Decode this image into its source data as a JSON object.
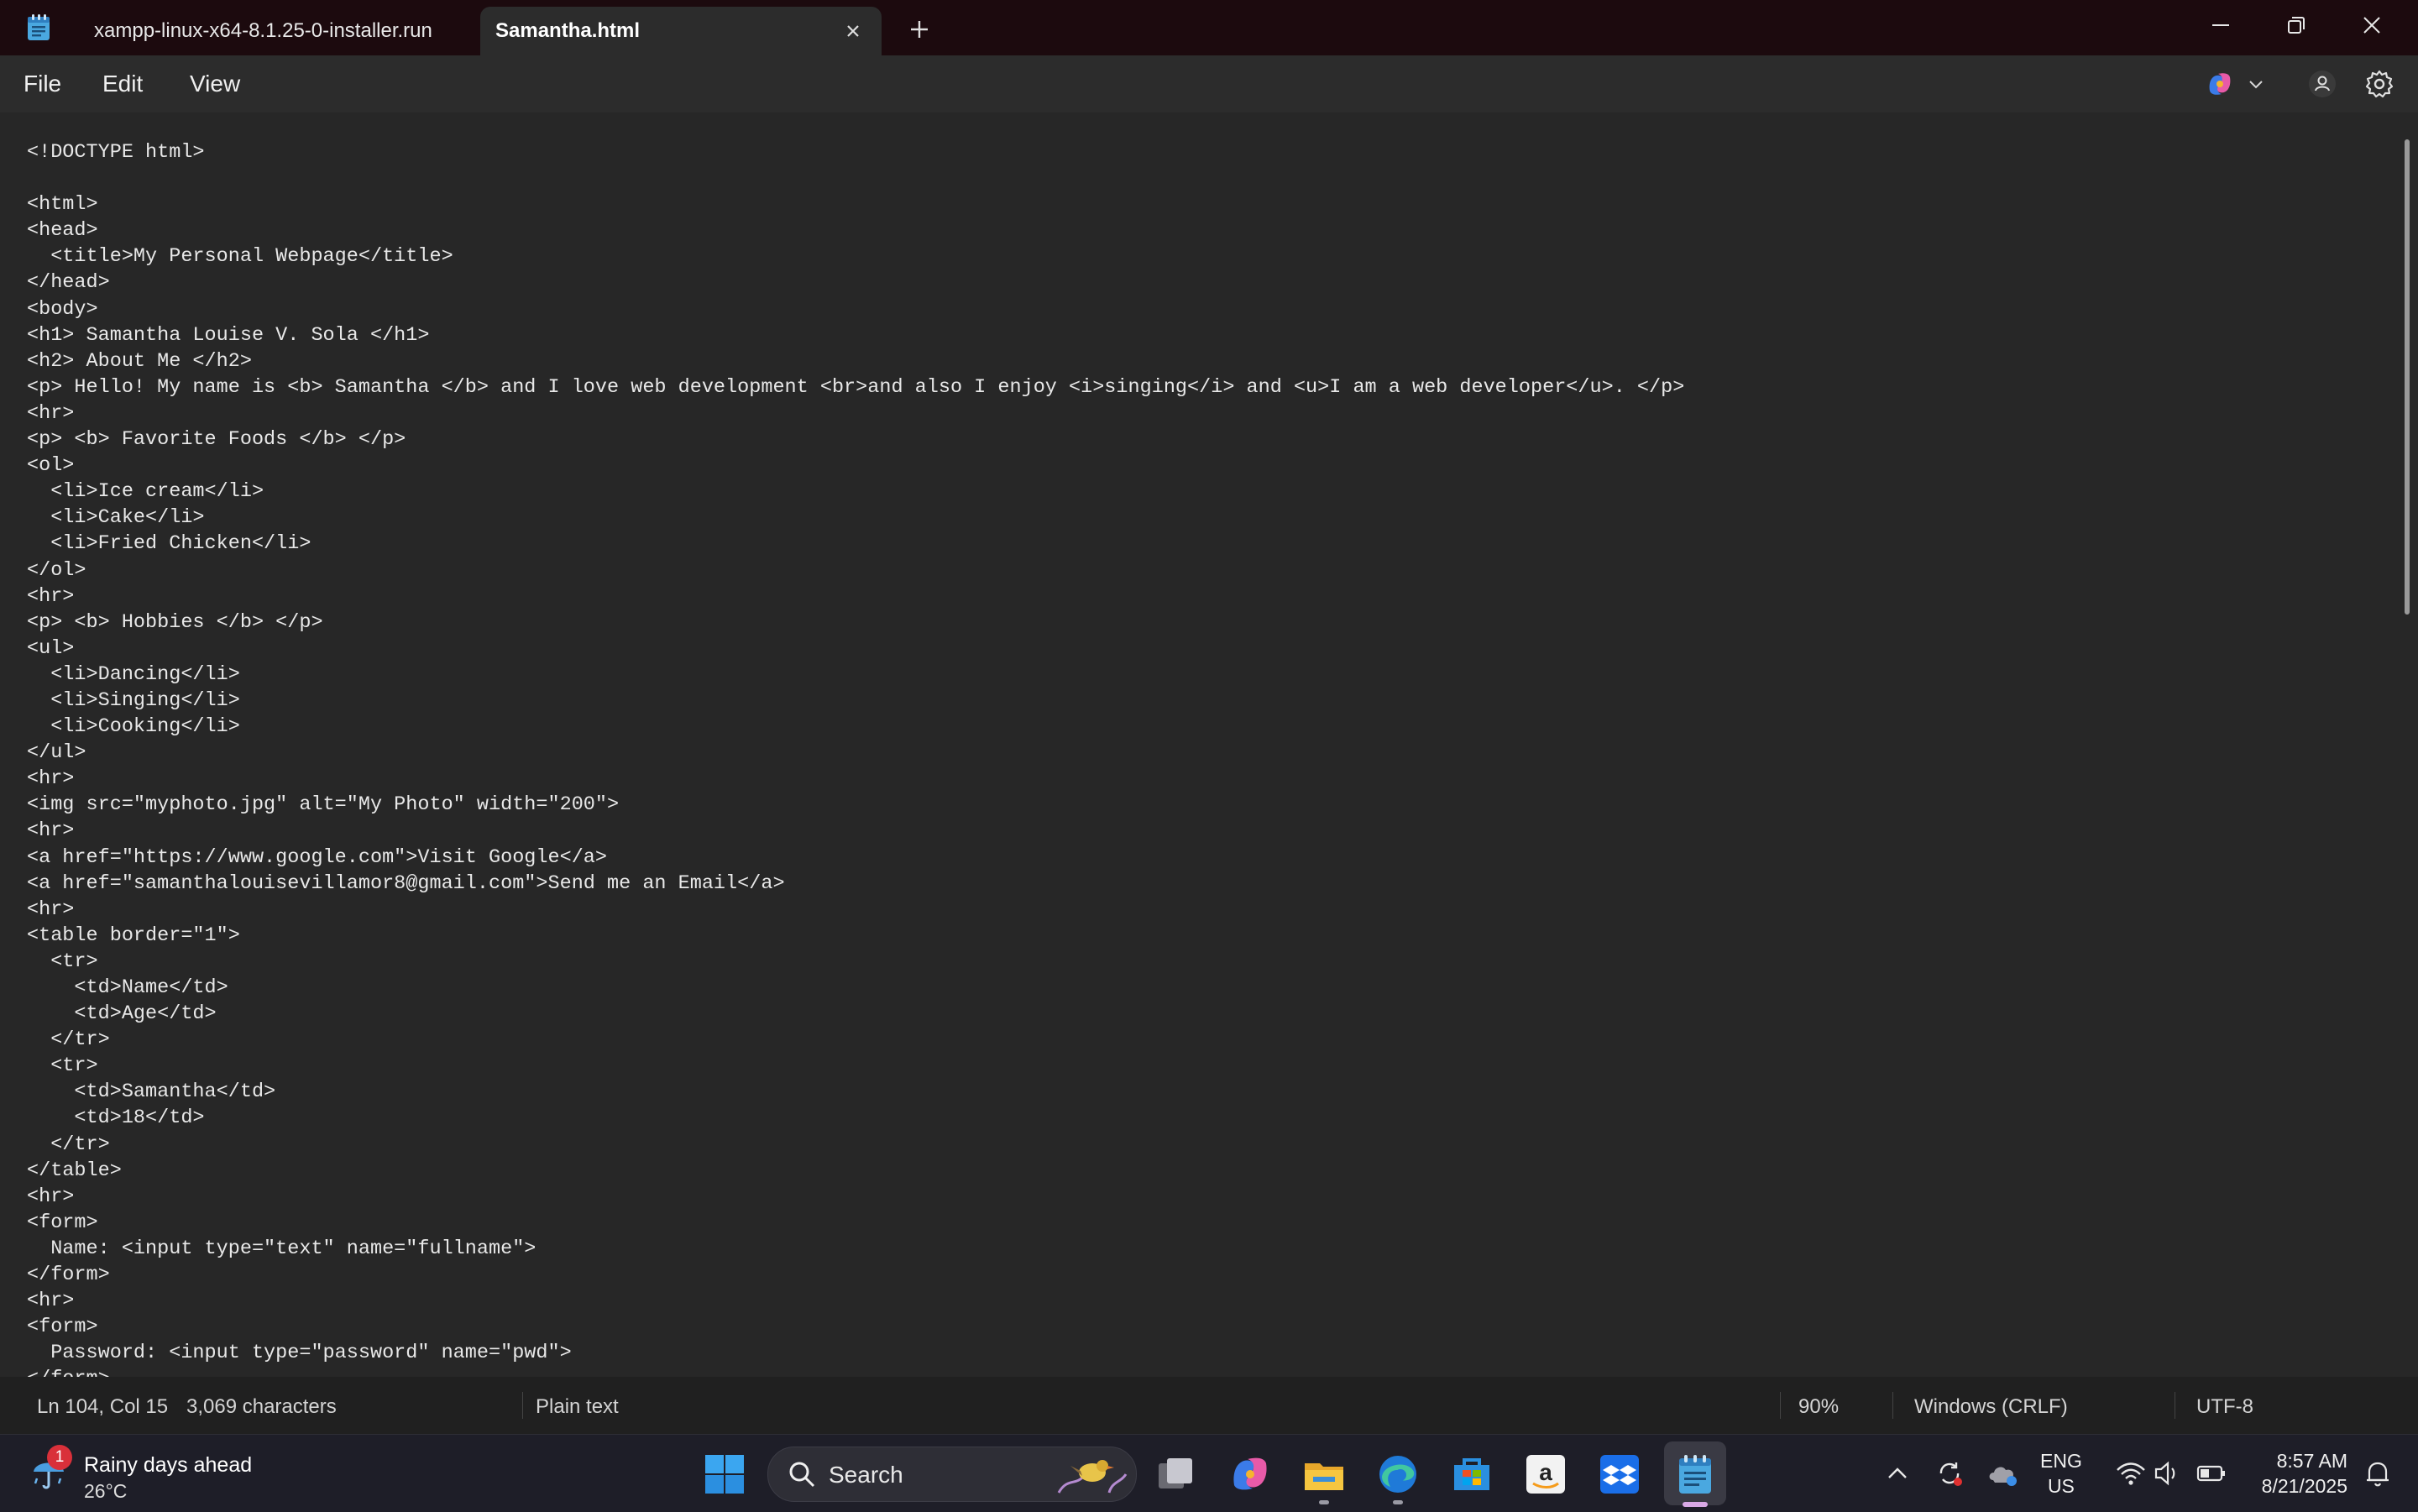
{
  "titlebar": {
    "tabs": [
      {
        "label": "xampp-linux-x64-8.1.25-0-installer.run"
      },
      {
        "label": "Samantha.html"
      }
    ]
  },
  "menu": {
    "file": "File",
    "edit": "Edit",
    "view": "View"
  },
  "editor": {
    "lines": [
      "<!DOCTYPE html>",
      "",
      "<html>",
      "<head>",
      "  <title>My Personal Webpage</title>",
      "</head>",
      "<body>",
      "<h1> Samantha Louise V. Sola </h1>",
      "<h2> About Me </h2>",
      "<p> Hello! My name is <b> Samantha </b> and I love web development <br>and also I enjoy <i>singing</i> and <u>I am a web developer</u>. </p>",
      "<hr>",
      "<p> <b> Favorite Foods </b> </p>",
      "<ol>",
      "  <li>Ice cream</li>",
      "  <li>Cake</li>",
      "  <li>Fried Chicken</li>",
      "</ol>",
      "<hr>",
      "<p> <b> Hobbies </b> </p>",
      "<ul>",
      "  <li>Dancing</li>",
      "  <li>Singing</li>",
      "  <li>Cooking</li>",
      "</ul>",
      "<hr>",
      "<img src=\"myphoto.jpg\" alt=\"My Photo\" width=\"200\">",
      "<hr>",
      "<a href=\"https://www.google.com\">Visit Google</a>",
      "<a href=\"samanthalouisevillamor8@gmail.com\">Send me an Email</a>",
      "<hr>",
      "<table border=\"1\">",
      "  <tr>",
      "    <td>Name</td>",
      "    <td>Age</td>",
      "  </tr>",
      "  <tr>",
      "    <td>Samantha</td>",
      "    <td>18</td>",
      "  </tr>",
      "</table>",
      "<hr>",
      "<form>",
      "  Name: <input type=\"text\" name=\"fullname\">",
      "</form>",
      "<hr>",
      "<form>",
      "  Password: <input type=\"password\" name=\"pwd\">",
      "</form>"
    ]
  },
  "status": {
    "position": "Ln 104, Col 15",
    "characters": "3,069 characters",
    "file_type": "Plain text",
    "zoom": "90%",
    "line_endings": "Windows (CRLF)",
    "encoding": "UTF-8"
  },
  "taskbar": {
    "weather_badge": "1",
    "weather_title": "Rainy days ahead",
    "weather_temp": "26°C",
    "search_label": "Search",
    "lang_line1": "ENG",
    "lang_line2": "US",
    "time": "8:57 AM",
    "date": "8/21/2025"
  },
  "colors": {
    "titlebar": "#1c0a0e",
    "editor_bg": "#272727",
    "accent_notepad": "#58b6e8"
  }
}
